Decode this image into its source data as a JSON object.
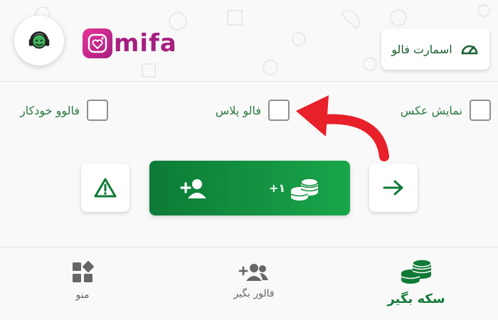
{
  "header": {
    "logo_text": "mifa",
    "smart_follow_label": "اسمارت فالو"
  },
  "options": [
    {
      "label": "نمایش عکس",
      "checked": false
    },
    {
      "label": "فالو پلاس",
      "checked": false
    },
    {
      "label": "فالوو خودکار",
      "checked": false
    }
  ],
  "actions": {
    "coin_value": "+۱",
    "follow_icon": "person-add-icon",
    "report_icon": "warning-icon",
    "next_icon": "arrow-right-icon"
  },
  "bottom_nav": [
    {
      "label": "سکه بگیر",
      "icon": "coins-icon",
      "active": true
    },
    {
      "label": "فالور بگیر",
      "icon": "people-add-icon",
      "active": false
    },
    {
      "label": "منو",
      "icon": "menu-shapes-icon",
      "active": false
    }
  ],
  "colors": {
    "primary_green": "#0f7a35",
    "accent_pink": "#a51f80",
    "annotation_red": "#e8202a"
  }
}
